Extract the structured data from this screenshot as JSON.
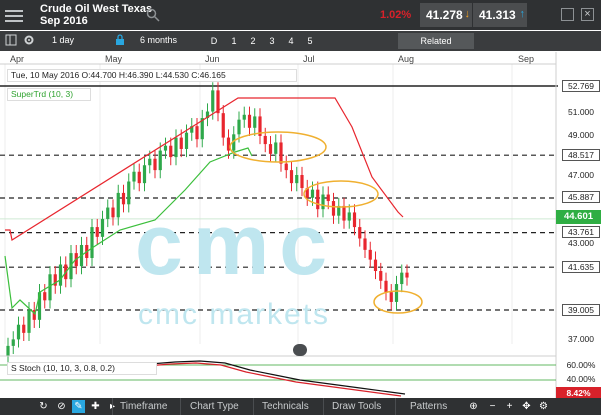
{
  "header": {
    "instrument_line1": "Crude Oil West Texas",
    "instrument_line2": "Sep 2016",
    "change": "1.02%",
    "sell_price": "41.278",
    "buy_price": "41.313",
    "icons": [
      "menu-icon",
      "search-icon",
      "sell-arrow-icon",
      "buy-arrow-icon",
      "popout-icon",
      "close-icon"
    ]
  },
  "toolbar": {
    "interval": "1 day",
    "range": "6 months",
    "buttons": [
      "D",
      "1",
      "2",
      "3",
      "4",
      "5"
    ],
    "related": "Related"
  },
  "chart": {
    "months": [
      "Apr",
      "May",
      "Jun",
      "Jul",
      "Aug",
      "Sep"
    ],
    "info_bar": "Tue, 10 May 2016 O:44.700  H:46.390  L:44.530  C:46.165",
    "indicator": "SuperTrd (10, 3)",
    "stoch_label": "S Stoch (10, 10, 3, 0.8, 0.2)",
    "boxed_levels": [
      "52.769",
      "48.517",
      "45.887",
      "43.761",
      "41.635",
      "39.005"
    ],
    "axis_levels": [
      "51.000",
      "49.000",
      "47.000",
      "43.000",
      "37.000"
    ],
    "current_price": "44.601",
    "stoch_ticks": [
      "60.00%",
      "40.00%"
    ],
    "stoch_value": "8.42%",
    "watermark_logo": "cmc",
    "watermark_text": "cmc markets",
    "colors": {
      "up": "#2ea84a",
      "down": "#e8262e",
      "supertrend_up": "#3cbf3c",
      "supertrend_down": "#e8262e",
      "current": "#2fae43",
      "highlight": "#f0b030"
    }
  },
  "bottom": {
    "tabs": [
      "Timeframe",
      "Chart Type",
      "Technicals",
      "Draw Tools",
      "Patterns"
    ],
    "icons": [
      "refresh-icon",
      "no-icon",
      "pencil-icon",
      "wrench-icon",
      "play-icon",
      "crosshair-icon",
      "zoom-out-icon",
      "zoom-in-icon",
      "fit-icon",
      "settings-icon"
    ]
  }
}
